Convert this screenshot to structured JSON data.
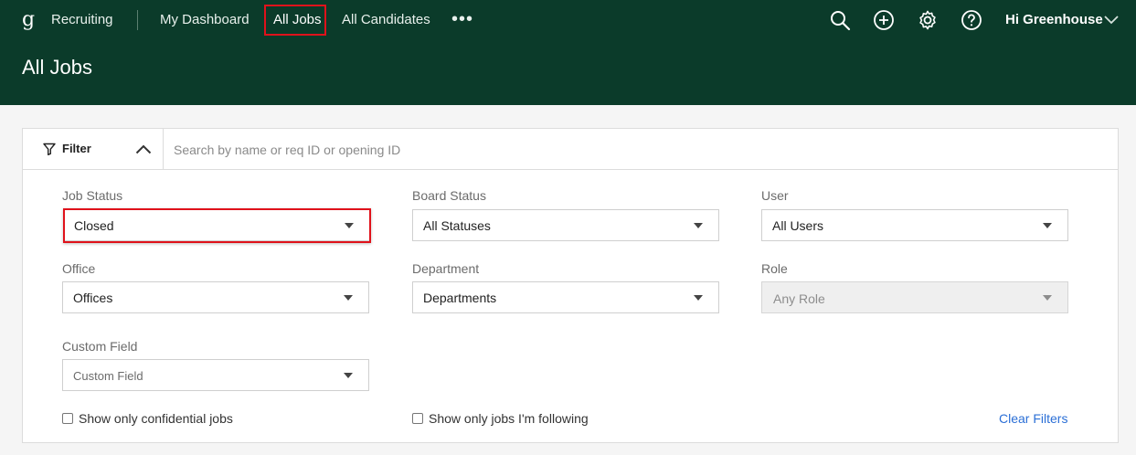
{
  "nav": {
    "app_name": "Recruiting",
    "items": [
      {
        "label": "My Dashboard"
      },
      {
        "label": "All Jobs",
        "active": true
      },
      {
        "label": "All Candidates"
      }
    ],
    "more": "•••",
    "user_greeting": "Hi Greenhouse",
    "icons": [
      "search-icon",
      "plus-circle-icon",
      "gear-icon",
      "help-icon",
      "chevron-down-icon"
    ]
  },
  "page": {
    "title": "All Jobs"
  },
  "filter": {
    "toggle_label": "Filter",
    "search_placeholder": "Search by name or req ID or opening ID",
    "fields": {
      "job_status": {
        "label": "Job Status",
        "value": "Closed"
      },
      "board_status": {
        "label": "Board Status",
        "value": "All Statuses"
      },
      "user": {
        "label": "User",
        "value": "All Users"
      },
      "office": {
        "label": "Office",
        "value": "Offices"
      },
      "department": {
        "label": "Department",
        "value": "Departments"
      },
      "role": {
        "label": "Role",
        "value": "Any Role",
        "disabled": true
      },
      "custom_field": {
        "label": "Custom Field",
        "value": "Custom Field"
      }
    },
    "checkboxes": {
      "confidential": "Show only confidential jobs",
      "following": "Show only jobs I'm following"
    },
    "clear_label": "Clear Filters"
  },
  "colors": {
    "header_bg": "#0b3b2a",
    "highlight": "#e0121b",
    "link": "#2b6fd6"
  }
}
